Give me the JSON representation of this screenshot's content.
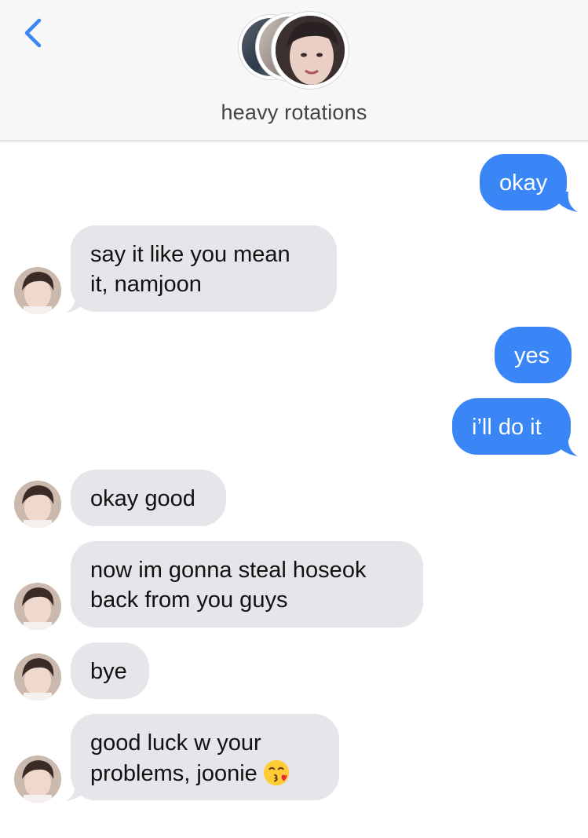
{
  "header": {
    "group_name": "heavy rotations",
    "back_icon": "chevron-left-icon",
    "accent": "#3b86f6"
  },
  "colors": {
    "sent_bubble": "#3b86f6",
    "received_bubble": "#e5e5ea"
  },
  "messages": [
    {
      "from": "me",
      "lines": [
        "okay"
      ]
    },
    {
      "from": "contact",
      "lines": [
        "say it like you mean",
        "it, namjoon"
      ]
    },
    {
      "from": "me",
      "lines": [
        "yes"
      ]
    },
    {
      "from": "me",
      "lines": [
        "i’ll do it"
      ]
    },
    {
      "from": "contact",
      "lines": [
        "okay good"
      ]
    },
    {
      "from": "contact",
      "lines": [
        "now im gonna steal hoseok",
        "back from you guys"
      ]
    },
    {
      "from": "contact",
      "lines": [
        "bye"
      ]
    },
    {
      "from": "contact",
      "lines": [
        "good luck w your",
        "problems, joonie"
      ],
      "emoji": "kissing-face-with-heart-icon"
    }
  ]
}
